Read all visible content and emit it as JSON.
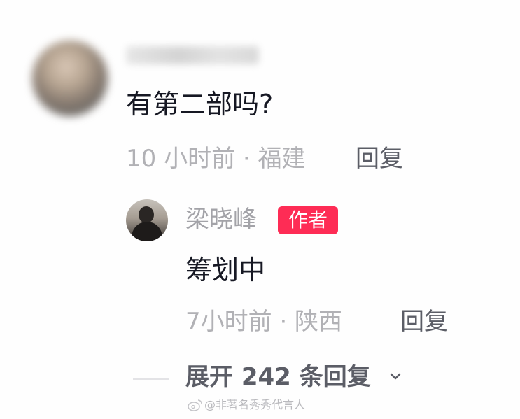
{
  "comment": {
    "text": "有第二部吗?",
    "meta": "10 小时前 · 福建",
    "reply_label": "回复"
  },
  "author_reply": {
    "name": "梁晓峰",
    "badge": "作者",
    "text": "筹划中",
    "meta": "7小时前 · 陕西",
    "reply_label": "回复"
  },
  "expand": {
    "label": "展开 242 条回复"
  },
  "watermark": {
    "text": "@非著名秀秀代言人"
  },
  "colors": {
    "badge_bg": "#fe2c55",
    "primary_text": "#161823",
    "secondary_text": "#b1b1b5"
  }
}
